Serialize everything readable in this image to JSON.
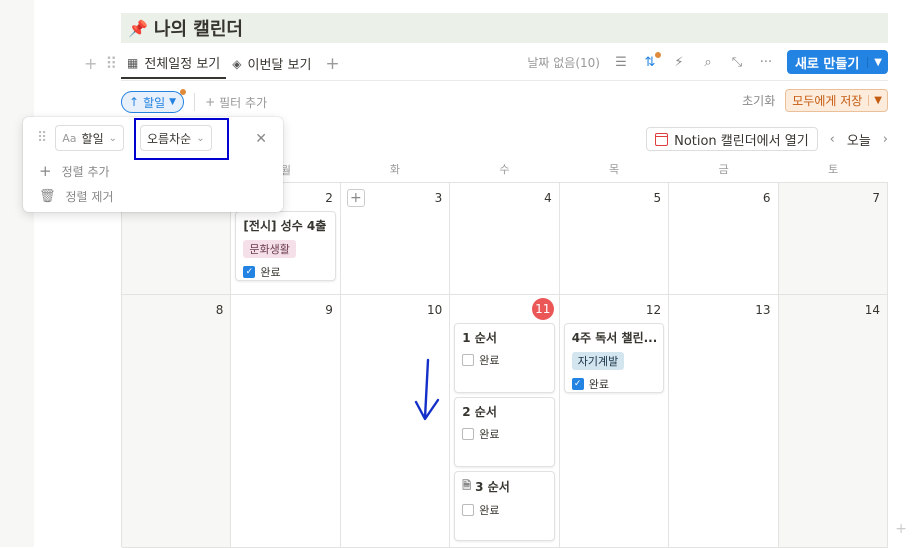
{
  "page_title": "나의 캘린더",
  "title_icon": "pushpin-icon",
  "tabs": [
    {
      "label": "전체일정 보기",
      "icon": "calendar-icon",
      "active": true
    },
    {
      "label": "이번달 보기",
      "icon": "layers-icon",
      "active": false
    }
  ],
  "toolbar": {
    "no_date": "날짜 없음(10)",
    "new_button": "새로 만들기"
  },
  "sort_pill": "할일",
  "add_filter": "필터 추가",
  "reset": "초기화",
  "save_all": "모두에게 저장",
  "open_notion_calendar": "Notion 캘린더에서 열기",
  "today": "오늘",
  "weekdays": [
    "월",
    "화",
    "수",
    "목",
    "금",
    "토"
  ],
  "week1_days": [
    "2",
    "3",
    "4",
    "5",
    "6",
    "7"
  ],
  "week2_days": [
    "8",
    "9",
    "10",
    "11",
    "12",
    "13",
    "14"
  ],
  "sort_popup": {
    "property": "할일",
    "property_type_icon": "Aa",
    "direction": "오름차순",
    "add_sort": "정렬 추가",
    "remove_sort": "정렬 제거"
  },
  "cards": {
    "exhibition": {
      "title": "[전시] 성수 4출",
      "tag": "문화생활",
      "check_label": "완료",
      "checked": true
    },
    "order1": {
      "title": "1 순서",
      "check_label": "완료",
      "checked": false
    },
    "order2": {
      "title": "2 순서",
      "check_label": "완료",
      "checked": false
    },
    "order3": {
      "title": "3 순서",
      "check_label": "완료",
      "checked": false
    },
    "reading": {
      "title": "4주 독서 챌린...",
      "tag": "자기계발",
      "check_label": "완료",
      "checked": true
    }
  },
  "colors": {
    "accent": "#2383e2",
    "today": "#eb5757",
    "highlight_box": "#0000d0",
    "title_bg": "#ebf1e9"
  }
}
